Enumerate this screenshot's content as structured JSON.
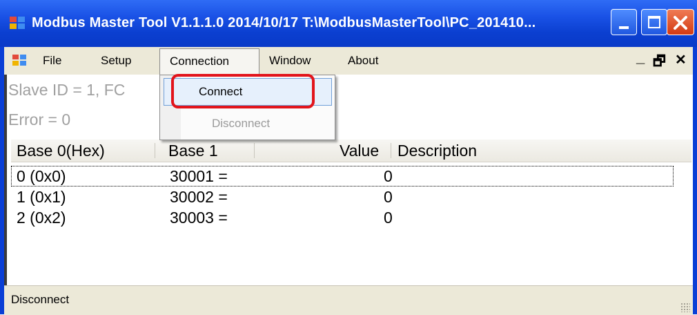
{
  "window": {
    "title": "Modbus Master Tool V1.1.1.0  2014/10/17   T:\\ModbusMasterTool\\PC_201410...",
    "icons": {
      "app": "app-grid-icon",
      "minimize": "minimize-icon",
      "maximize": "maximize-icon",
      "close": "close-icon"
    }
  },
  "menubar": {
    "items": [
      {
        "label": "File"
      },
      {
        "label": "Setup"
      },
      {
        "label": "Connection"
      },
      {
        "label": "Window"
      },
      {
        "label": "About"
      }
    ],
    "mdi_controls": {
      "minimize": "_",
      "restore": "🗗",
      "close": "✕"
    }
  },
  "dropdown": {
    "items": [
      {
        "label": "Connect",
        "enabled": true,
        "highlighted": true
      },
      {
        "label": "Disconnect",
        "enabled": false
      }
    ]
  },
  "info": {
    "line1": "Slave ID = 1, FC",
    "line2": "Error = 0"
  },
  "grid": {
    "columns": [
      "Base 0(Hex)",
      "Base 1",
      "Value",
      "Description"
    ],
    "rows": [
      {
        "base0": "0 (0x0)",
        "base1": "30001  =",
        "value": "0",
        "description": ""
      },
      {
        "base0": "1 (0x1)",
        "base1": "30002  =",
        "value": "0",
        "description": ""
      },
      {
        "base0": "2 (0x2)",
        "base1": "30003  =",
        "value": "0",
        "description": ""
      }
    ]
  },
  "status": {
    "text": "Disconnect"
  },
  "colors": {
    "titlebar": "#0a3ac8",
    "highlight_ring": "#e2141b",
    "menu_bg": "#ece9d8"
  }
}
